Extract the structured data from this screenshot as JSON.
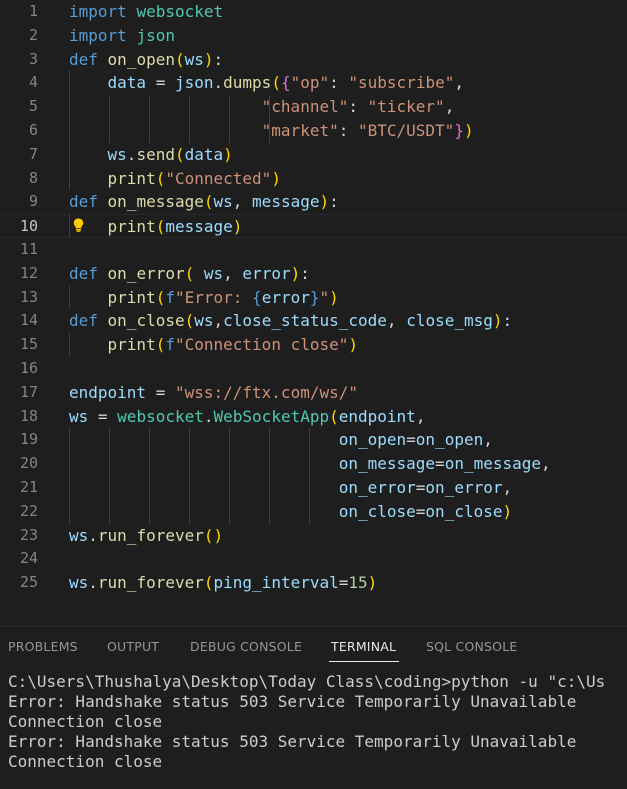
{
  "editor": {
    "line_numbers": [
      "1",
      "2",
      "3",
      "4",
      "5",
      "6",
      "7",
      "8",
      "9",
      "10",
      "11",
      "12",
      "13",
      "14",
      "15",
      "16",
      "17",
      "18",
      "19",
      "20",
      "21",
      "22",
      "23",
      "24",
      "25"
    ],
    "current_line": "10"
  },
  "panel": {
    "tabs": [
      "PROBLEMS",
      "OUTPUT",
      "DEBUG CONSOLE",
      "TERMINAL",
      "SQL CONSOLE"
    ],
    "active_tab": "TERMINAL"
  },
  "terminal": {
    "lines": [
      "C:\\Users\\Thushalya\\Desktop\\Today Class\\coding>python -u \"c:\\Us",
      "Error: Handshake status 503 Service Temporarily Unavailable",
      "Connection close",
      "Error: Handshake status 503 Service Temporarily Unavailable",
      "Connection close"
    ]
  },
  "colors": {
    "background": "#1e1e1e",
    "keyword": "#569cd6",
    "module": "#4ec9b0",
    "function": "#dcdcaa",
    "variable": "#9cdcfe",
    "string": "#ce9178",
    "number": "#b5cea8",
    "bracket_gold": "#ffd700",
    "bracket_orchid": "#da70d6",
    "bracket_blue": "#179fff"
  },
  "icons": {
    "lightbulb": "lightbulb-icon"
  }
}
